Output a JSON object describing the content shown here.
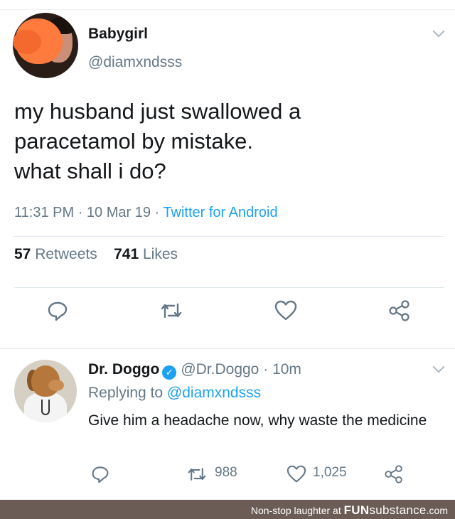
{
  "tweet": {
    "display_name": "Babygirl",
    "handle": "@diamxndsss",
    "text_lines": [
      "my husband just swallowed a",
      "paracetamol by mistake.",
      "what shall i do?"
    ],
    "time": "11:31 PM",
    "date": "10 Mar 19",
    "separator": "·",
    "source": "Twitter for Android",
    "retweets_count": "57",
    "retweets_label": "Retweets",
    "likes_count": "741",
    "likes_label": "Likes"
  },
  "reply": {
    "display_name": "Dr. Doggo",
    "handle": "@Dr.Doggo",
    "separator": "·",
    "time_ago": "10m",
    "replying_prefix": "Replying to",
    "replying_to": "@diamxndsss",
    "text": "Give him a headache now, why waste the medicine",
    "retweets_count": "988",
    "likes_count": "1,025"
  },
  "icons": {
    "reply": "reply-icon",
    "retweet": "retweet-icon",
    "like": "heart-icon",
    "share": "share-icon",
    "more": "chevron-down-icon",
    "verified": "verified-badge-icon"
  },
  "colors": {
    "link_blue": "#1da1f2",
    "muted_gray": "#657786",
    "text_dark": "#14171a",
    "footer_bg": "#6b5c55"
  },
  "footer": {
    "prefix": "Non-stop laughter at",
    "brand_bold": "FUN",
    "brand_rest": "substance",
    "brand_suffix": ".com"
  }
}
